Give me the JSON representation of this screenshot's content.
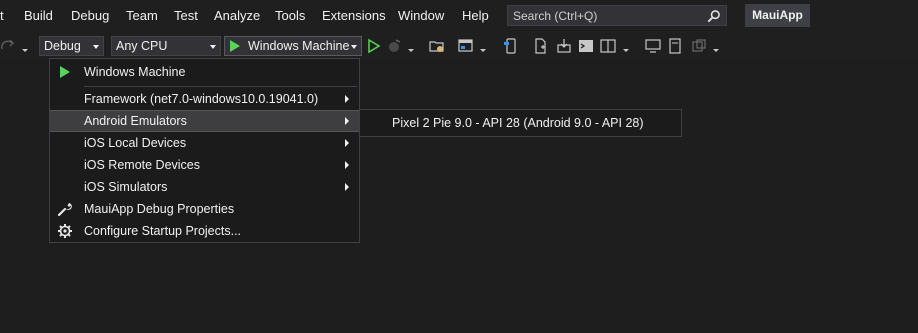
{
  "menubar": {
    "items": [
      "t",
      "Build",
      "Debug",
      "Team",
      "Test",
      "Analyze",
      "Tools",
      "Extensions",
      "Window",
      "Help"
    ],
    "search_placeholder": "Search (Ctrl+Q)",
    "app_name": "MauiApp"
  },
  "toolbar": {
    "configuration": "Debug",
    "platform": "Any CPU",
    "run_target": "Windows Machine"
  },
  "dropdown": {
    "items": [
      {
        "label": "Windows Machine",
        "icon": "play-icon"
      },
      {
        "label": "Framework (net7.0-windows10.0.19041.0)",
        "submenu": true
      },
      {
        "label": "Android Emulators",
        "submenu": true,
        "highlighted": true
      },
      {
        "label": "iOS Local Devices",
        "submenu": true
      },
      {
        "label": "iOS Remote Devices",
        "submenu": true
      },
      {
        "label": "iOS Simulators",
        "submenu": true
      },
      {
        "label": "MauiApp Debug Properties",
        "icon": "wrench-icon"
      },
      {
        "label": "Configure Startup Projects...",
        "icon": "gear-icon"
      }
    ]
  },
  "submenu": {
    "items": [
      "Pixel 2 Pie 9.0 - API 28 (Android 9.0 - API 28)"
    ]
  },
  "colors": {
    "background": "#1e1e1e",
    "menu_bg": "#1b1b1c",
    "highlight": "#3e3e40",
    "accent_green": "#5bd35b",
    "text": "#f1f1f1"
  }
}
